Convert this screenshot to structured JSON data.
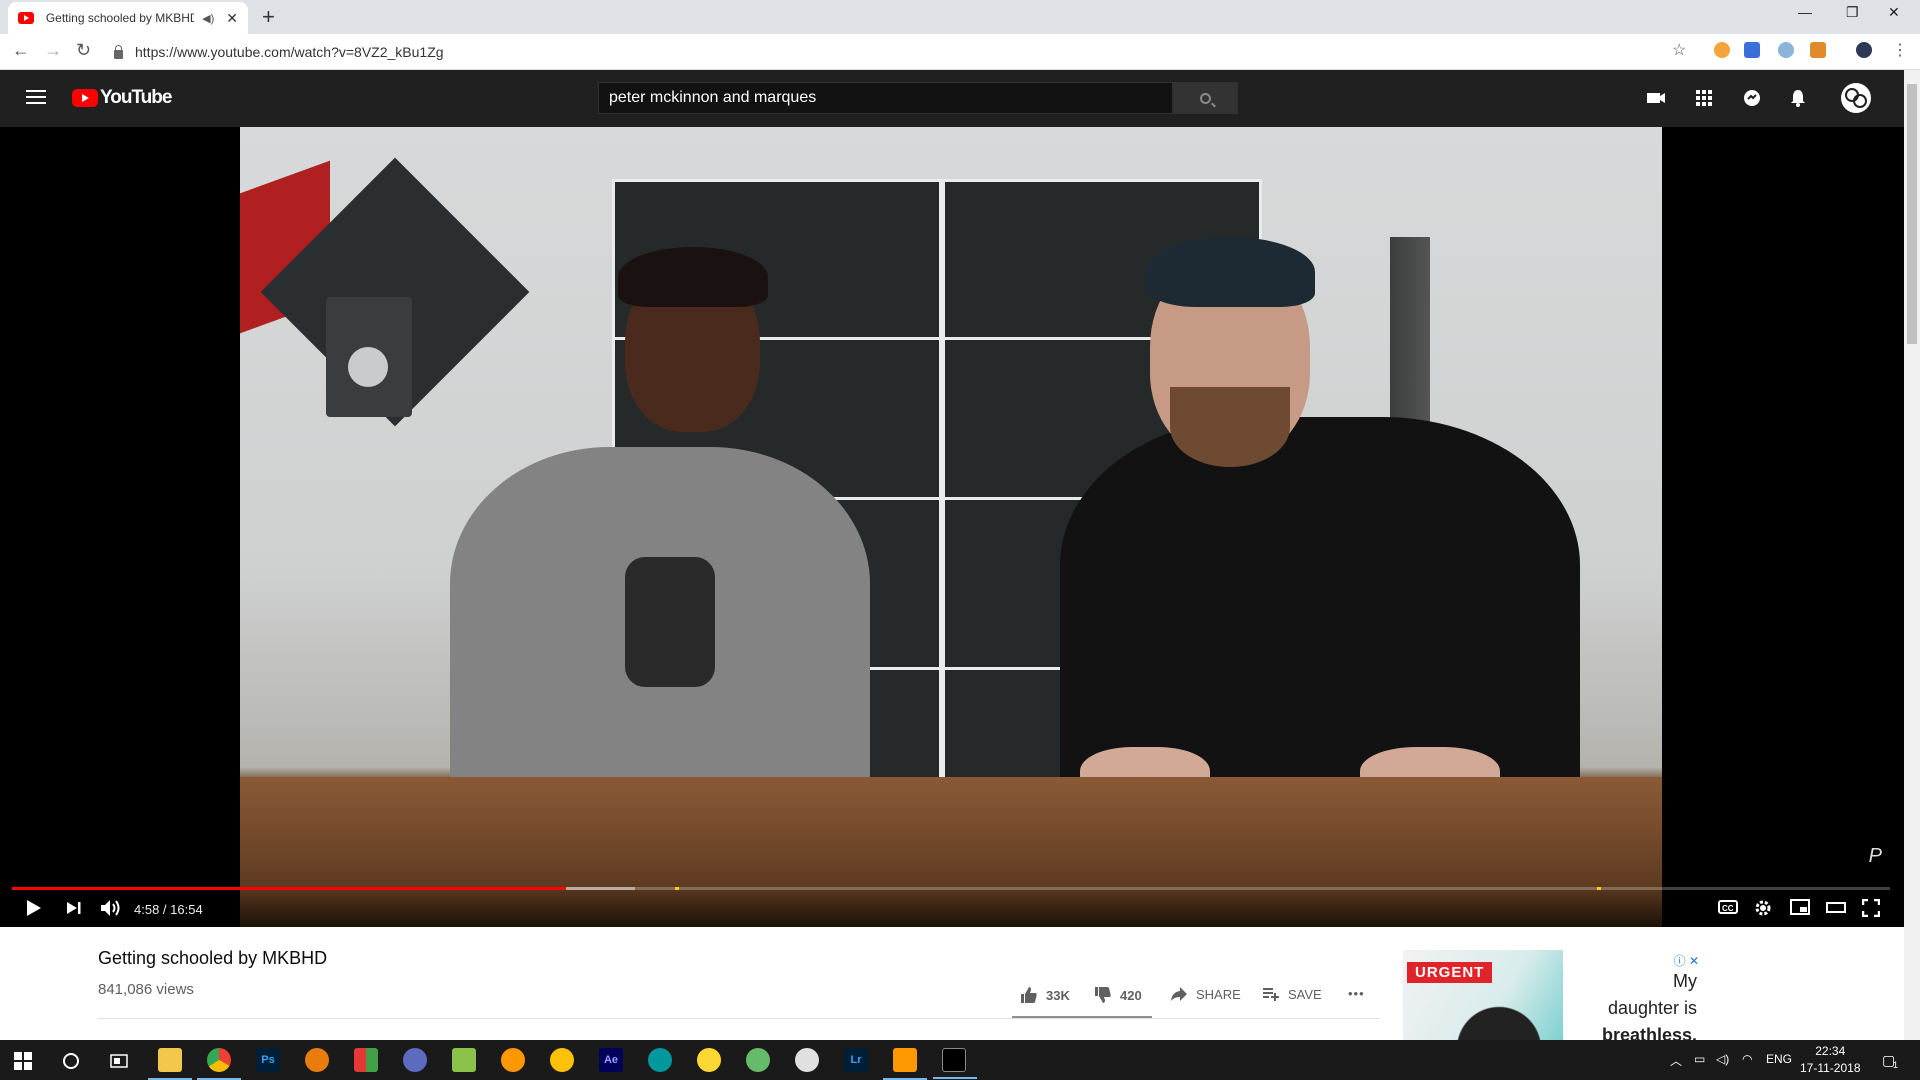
{
  "browser": {
    "tab_title": "Getting schooled by MKBHD",
    "new_tab": "+",
    "url": "https://www.youtube.com/watch?v=8VZ2_kBu1Zg",
    "controls": {
      "minimize": "—",
      "restore": "❐",
      "close": "✕"
    }
  },
  "youtube": {
    "logo_text": "YouTube",
    "search_value": "peter mckinnon and marques"
  },
  "player": {
    "time": "4:58 / 16:54",
    "progress_played": 0.295,
    "progress_buffered": 0.332,
    "chapter_marks": [
      0.353,
      0.844
    ],
    "watermark": "P"
  },
  "video": {
    "title": "Getting schooled by MKBHD",
    "views": "841,086 views",
    "likes": "33K",
    "dislikes": "420",
    "share_label": "SHARE",
    "save_label": "SAVE",
    "more_label": "•••"
  },
  "ad": {
    "tag": "URGENT",
    "line1": "My",
    "line2": "daughter is",
    "line3": "breathless."
  },
  "taskbar": {
    "lang": "ENG",
    "time": "22:34",
    "date": "17-11-2018",
    "notif_count": "1",
    "apps": [
      "Ps",
      "Ae",
      "Lr"
    ]
  },
  "colors": {
    "accent": "#ff0000",
    "header_bg": "#202020",
    "taskbar_bg": "#1a1a1a"
  }
}
